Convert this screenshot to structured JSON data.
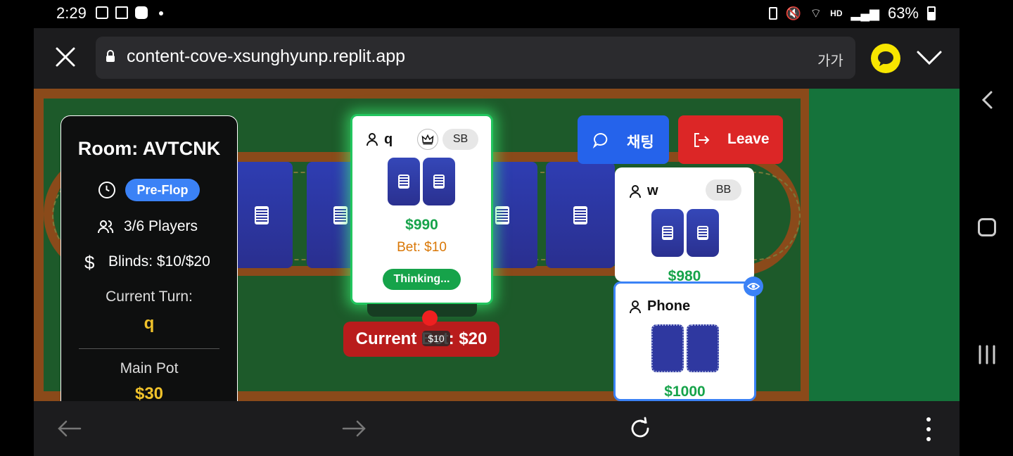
{
  "status_bar": {
    "time": "2:29",
    "battery": "63%",
    "icons": [
      "gallery-icon",
      "gmail-icon",
      "ad-block-icon",
      "notification-dot",
      "battery-saver-icon",
      "mute-icon",
      "wifi-icon",
      "hd-voice-icon",
      "signal-icon",
      "battery-icon"
    ]
  },
  "browser": {
    "url": "content-cove-xsunghyunp.replit.app",
    "text_size_label": "가가",
    "icons": [
      "close-icon",
      "lock-icon",
      "kakao-talk-icon",
      "chevron-down-icon"
    ]
  },
  "game": {
    "room_title": "Room: AVTCNK",
    "phase": "Pre-Flop",
    "players_count": "3/6 Players",
    "blinds": "Blinds: $10/$20",
    "current_turn_label": "Current Turn:",
    "current_turn_value": "q",
    "main_pot_label": "Main Pot",
    "main_pot_value": "$30",
    "current_bet": "Current Bet: $20",
    "chip_label": "$10",
    "chat_button": "채팅",
    "leave_button": "Leave",
    "players": [
      {
        "name": "q",
        "badge": "SB",
        "stack": "$990",
        "bet": "Bet: $10",
        "status": "Thinking..."
      },
      {
        "name": "w",
        "badge": "BB",
        "stack": "$980"
      },
      {
        "name": "Phone",
        "stack": "$1000"
      }
    ]
  },
  "colors": {
    "felt": "#1d5a2a",
    "rail": "#8a4a1a",
    "accent_blue": "#3b82f6",
    "leave_red": "#dc2626",
    "stack_green": "#16a34a",
    "gold": "#f0c22b"
  }
}
